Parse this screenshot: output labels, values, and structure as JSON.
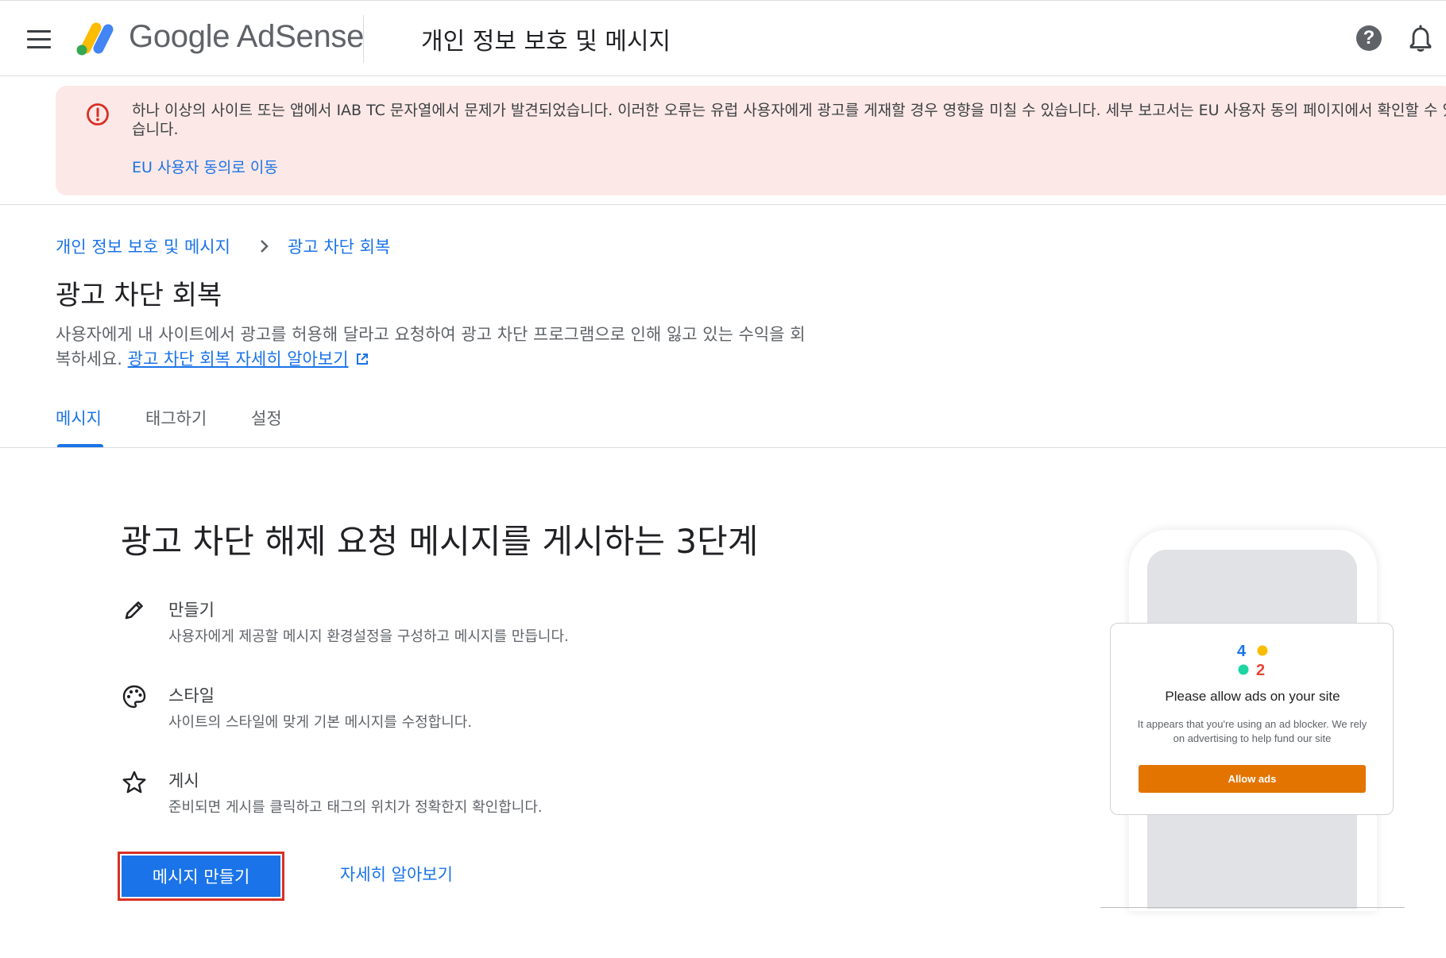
{
  "header": {
    "logo_text": "Google AdSense",
    "title": "개인 정보 보호 및 메시지",
    "help_glyph": "?"
  },
  "alert": {
    "message": "하나 이상의 사이트 또는 앱에서 IAB TC 문자열에서 문제가 발견되었습니다. 이러한 오류는 유럽 사용자에게 광고를 게재할 경우 영향을 미칠 수 있습니다. 세부 보고서는 EU 사용자 동의 페이지에서 확인할 수 있습니다.",
    "link_label": "EU 사용자 동의로 이동",
    "color": "#d93025",
    "background": "#fce8e6"
  },
  "breadcrumb": {
    "items": [
      "개인 정보 보호 및 메시지",
      "광고 차단 회복"
    ]
  },
  "page": {
    "title": "광고 차단 회복",
    "description": "사용자에게 내 사이트에서 광고를 허용해 달라고 요청하여 광고 차단 프로그램으로 인해 잃고 있는 수익을 회복하세요.",
    "learn_more_link": "광고 차단 회복 자세히 알아보기"
  },
  "tabs": [
    {
      "label": "메시지",
      "active": true
    },
    {
      "label": "태그하기",
      "active": false
    },
    {
      "label": "설정",
      "active": false
    }
  ],
  "main": {
    "heading": "광고 차단 해제 요청 메시지를 게시하는 3단계",
    "steps": [
      {
        "icon": "pencil-icon",
        "title": "만들기",
        "description": "사용자에게 제공할 메시지 환경설정을 구성하고 메시지를 만듭니다."
      },
      {
        "icon": "palette-icon",
        "title": "스타일",
        "description": "사이트의 스타일에 맞게 기본 메시지를 수정합니다."
      },
      {
        "icon": "star-icon",
        "title": "게시",
        "description": "준비되면 게시를 클릭하고 태그의 위치가 정확한지 확인합니다."
      }
    ],
    "primary_button": "메시지 만들기",
    "secondary_link": "자세히 알아보기"
  },
  "illustration": {
    "logo_digits": [
      "4",
      "2"
    ],
    "card_title": "Please allow ads on your site",
    "card_body": "It appears that you're using an ad blocker. We rely on advertising to help fund our site",
    "card_button": "Allow ads",
    "button_color": "#e37400"
  },
  "colors": {
    "accent": "#1a73e8",
    "error": "#d93025"
  }
}
